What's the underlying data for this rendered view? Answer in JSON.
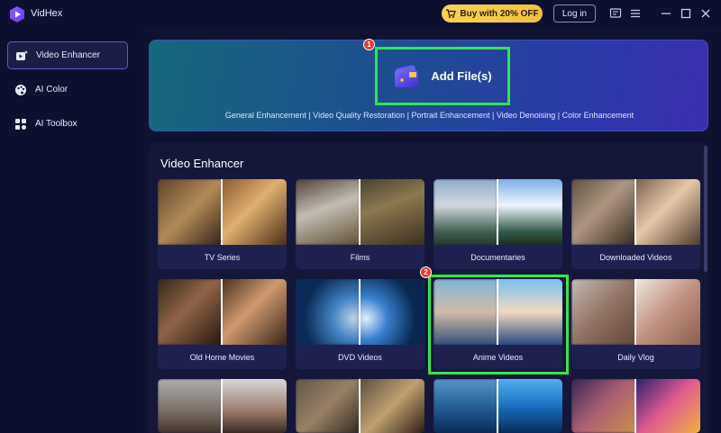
{
  "app": {
    "name": "VidHex"
  },
  "titlebar": {
    "buy_label": "Buy with 20% OFF",
    "login_label": "Log in"
  },
  "sidebar": {
    "items": [
      {
        "label": "Video Enhancer",
        "icon": "video-enhancer-icon",
        "active": true
      },
      {
        "label": "AI Color",
        "icon": "palette-icon",
        "active": false
      },
      {
        "label": "AI Toolbox",
        "icon": "toolbox-icon",
        "active": false
      }
    ]
  },
  "banner": {
    "add_label": "Add File(s)",
    "subtitle": "General Enhancement | Video Quality Restoration | Portrait Enhancement | Video Denoising | Color Enhancement",
    "badge": "1"
  },
  "panel": {
    "title": "Video Enhancer",
    "badge": "2",
    "cards": [
      {
        "label": "TV Series"
      },
      {
        "label": "Films"
      },
      {
        "label": "Documentaries"
      },
      {
        "label": "Downloaded Videos"
      },
      {
        "label": "Old Home Movies"
      },
      {
        "label": "DVD Videos"
      },
      {
        "label": "Anime Videos"
      },
      {
        "label": "Daily Vlog"
      }
    ]
  },
  "colors": {
    "accent": "#5a5fc9",
    "highlight": "#2ee84a",
    "badge": "#e53935",
    "buy": "#f4c13c"
  }
}
